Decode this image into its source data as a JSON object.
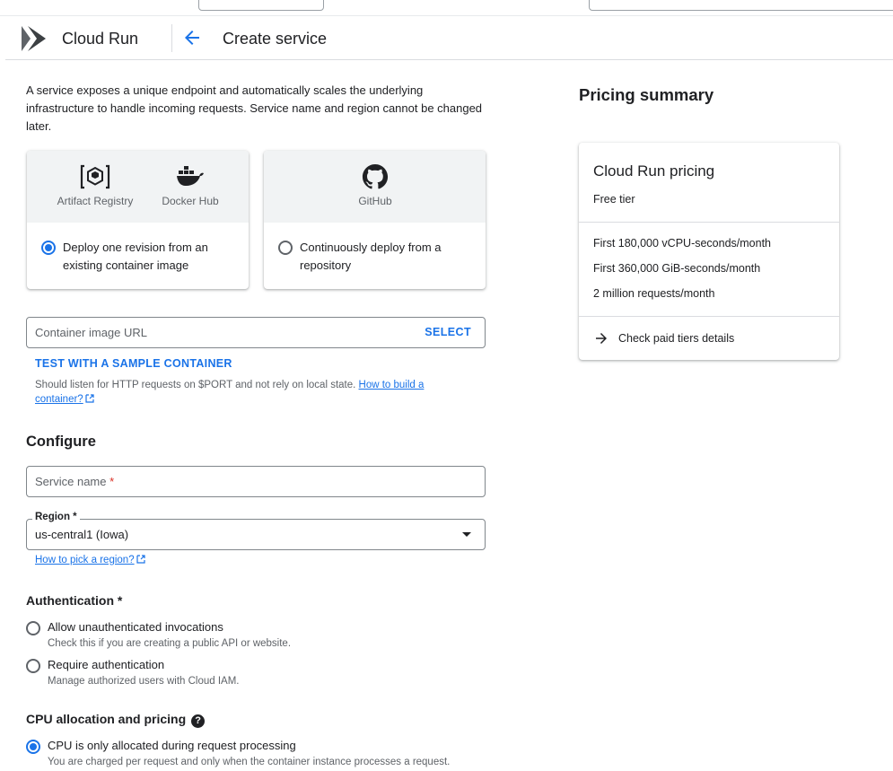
{
  "header": {
    "product_name": "Cloud Run",
    "page_title": "Create service"
  },
  "intro": "A service exposes a unique endpoint and automatically scales the underlying infrastructure to handle incoming requests. Service name and region cannot be changed later.",
  "deploy_cards": [
    {
      "sources": [
        "Artifact Registry",
        "Docker Hub"
      ],
      "label": "Deploy one revision from an existing container image",
      "selected": true
    },
    {
      "sources": [
        "GitHub"
      ],
      "label": "Continuously deploy from a repository",
      "selected": false
    }
  ],
  "container": {
    "placeholder": "Container image URL",
    "select_label": "SELECT",
    "sample_label": "TEST WITH A SAMPLE CONTAINER",
    "hint_text": "Should listen for HTTP requests on $PORT and not rely on local state. ",
    "hint_link": "How to build a container?"
  },
  "configure": {
    "heading": "Configure",
    "service_name_placeholder": "Service name",
    "required_mark": "*",
    "region_label": "Region *",
    "region_value": "us-central1 (Iowa)",
    "region_help": "How to pick a region?"
  },
  "authentication": {
    "heading": "Authentication *",
    "options": [
      {
        "label": "Allow unauthenticated invocations",
        "desc": "Check this if you are creating a public API or website.",
        "selected": false
      },
      {
        "label": "Require authentication",
        "desc": "Manage authorized users with Cloud IAM.",
        "selected": false
      }
    ]
  },
  "cpu": {
    "heading": "CPU allocation and pricing",
    "help_glyph": "?",
    "options": [
      {
        "label": "CPU is only allocated during request processing",
        "desc": "You are charged per request and only when the container instance processes a request.",
        "selected": true
      }
    ]
  },
  "pricing": {
    "heading": "Pricing summary",
    "card_title": "Cloud Run pricing",
    "card_subtitle": "Free tier",
    "tiers": [
      "First 180,000 vCPU-seconds/month",
      "First 360,000 GiB-seconds/month",
      "2 million requests/month"
    ],
    "paid_link": "Check paid tiers details"
  },
  "colors": {
    "accent": "#1a73e8",
    "text": "#202124",
    "secondary_text": "#5f6368",
    "required": "#d93025"
  },
  "icons": [
    "cloud-run-icon",
    "back-arrow-icon",
    "artifact-registry-icon",
    "docker-icon",
    "github-icon",
    "external-link-icon",
    "dropdown-arrow-icon",
    "help-icon",
    "arrow-right-icon"
  ]
}
